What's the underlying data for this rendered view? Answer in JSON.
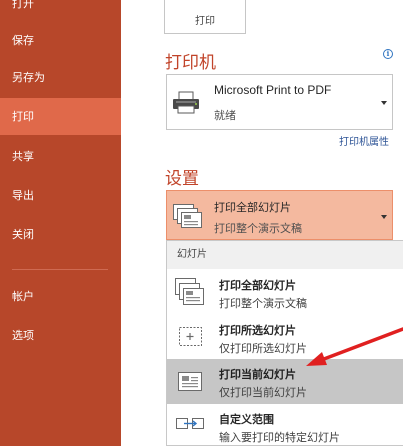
{
  "sidebar": {
    "items": [
      {
        "label": "打开",
        "active": false
      },
      {
        "label": "保存",
        "active": false
      },
      {
        "label": "另存为",
        "active": false
      },
      {
        "label": "打印",
        "active": true
      },
      {
        "label": "共享",
        "active": false
      },
      {
        "label": "导出",
        "active": false
      },
      {
        "label": "关闭",
        "active": false
      },
      {
        "label": "帐户",
        "active": false
      },
      {
        "label": "选项",
        "active": false
      }
    ]
  },
  "print_button": {
    "label": "打印"
  },
  "printer": {
    "heading": "打印机",
    "info_icon": "i",
    "selected_name": "Microsoft Print to PDF",
    "selected_status": "就绪",
    "properties_link": "打印机属性"
  },
  "settings": {
    "heading": "设置",
    "slides_select": {
      "title": "打印全部幻灯片",
      "subtitle": "打印整个演示文稿"
    }
  },
  "slides_menu": {
    "group_header": "幻灯片",
    "options": [
      {
        "icon": "all-slides-icon",
        "title": "打印全部幻灯片",
        "description": "打印整个演示文稿",
        "selected": false
      },
      {
        "icon": "selected-slides-icon",
        "title": "打印所选幻灯片",
        "description": "仅打印所选幻灯片",
        "selected": false
      },
      {
        "icon": "current-slide-icon",
        "title": "打印当前幻灯片",
        "description": "仅打印当前幻灯片",
        "selected": true
      },
      {
        "icon": "custom-range-icon",
        "title": "自定义范围",
        "description": "输入要打印的特定幻灯片",
        "selected": false
      }
    ]
  },
  "colors": {
    "sidebar": "#b7472a",
    "sidebar_active": "#e0694a",
    "accent_heading": "#c1442a",
    "dropdown_highlight": "#f4b99f",
    "annotation_arrow": "#e02020"
  }
}
